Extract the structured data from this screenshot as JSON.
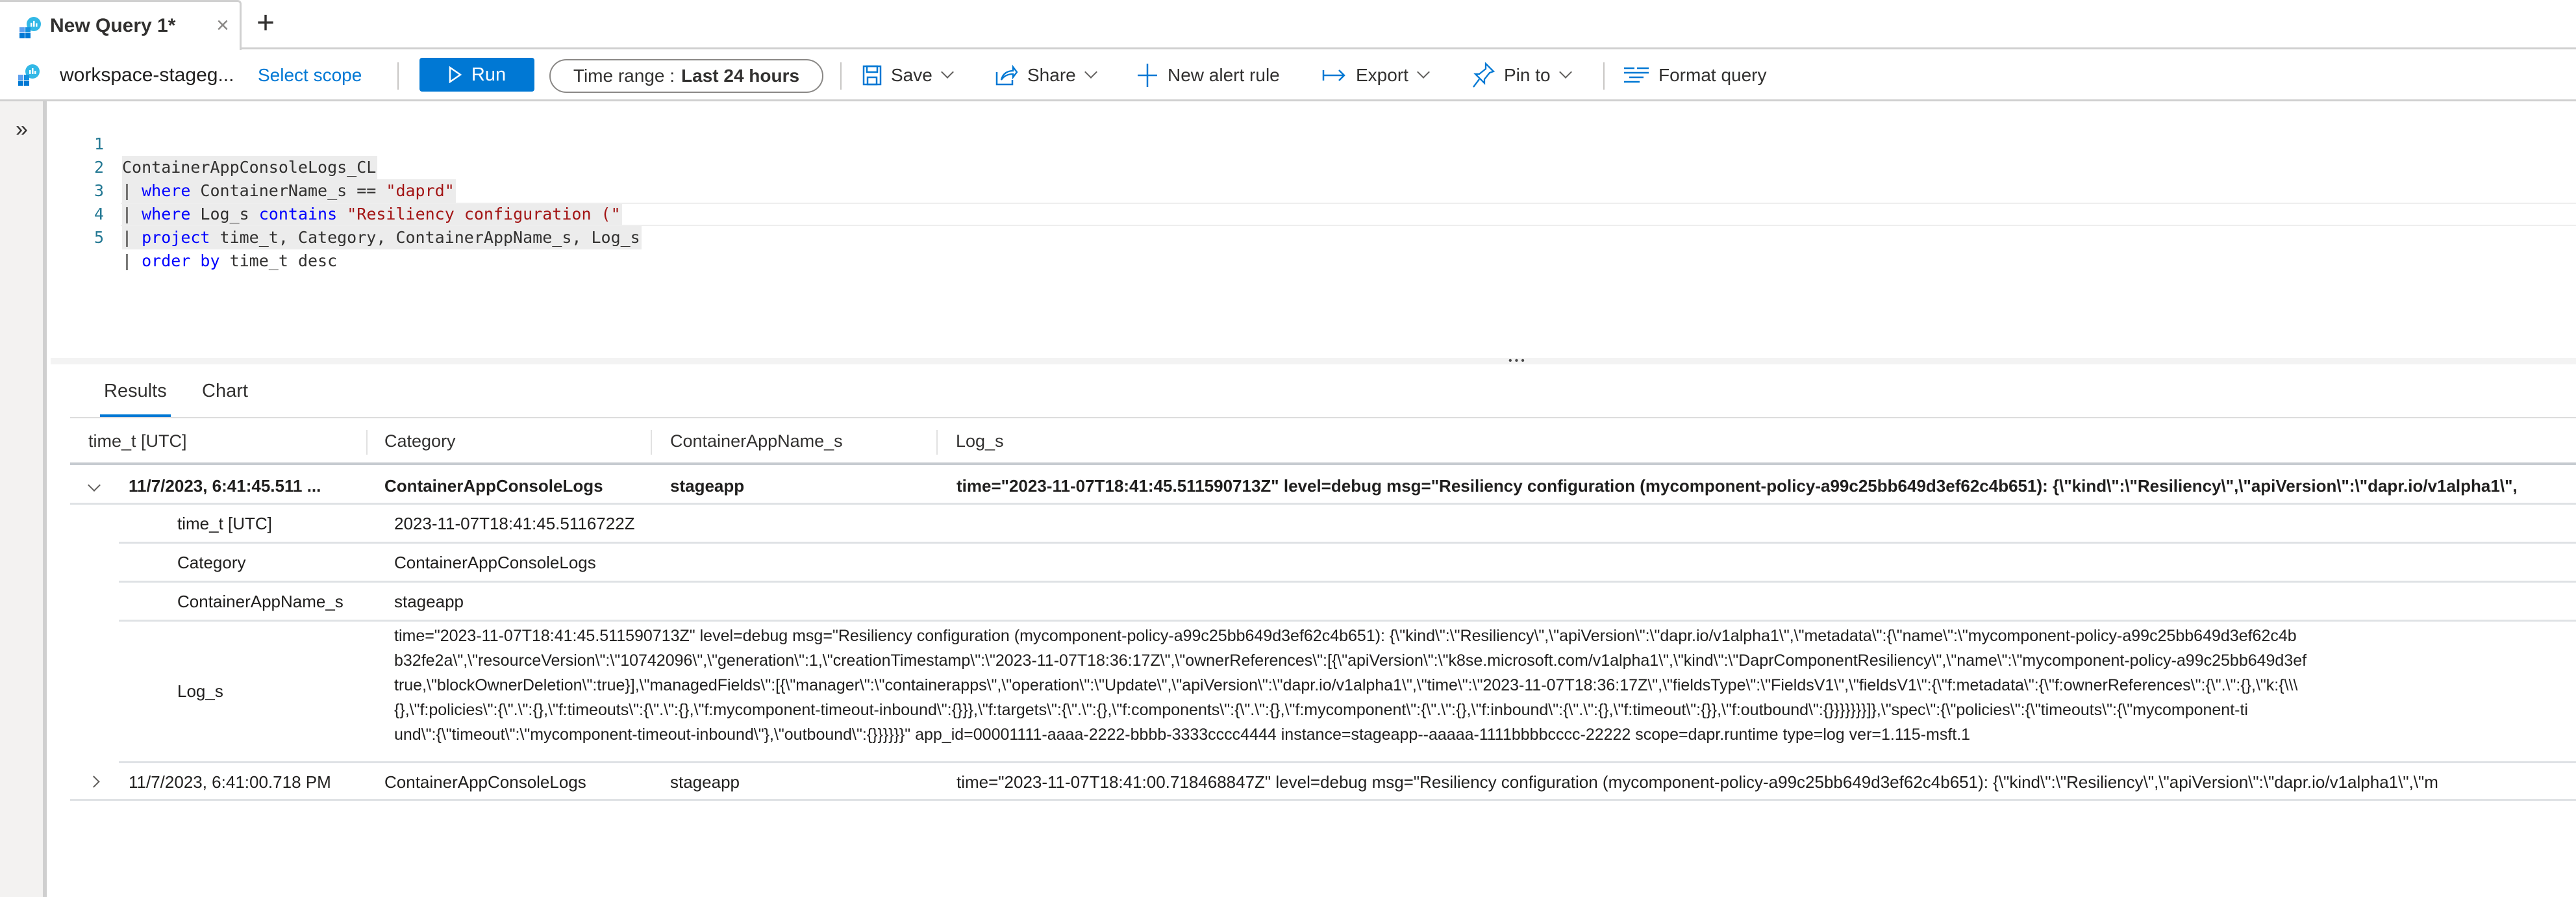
{
  "tab": {
    "title": "New Query 1*",
    "close_icon": "×",
    "add_icon": "+"
  },
  "toolbar": {
    "workspace": "workspace-stageg...",
    "select_scope": "Select scope",
    "run": "Run",
    "time_range_label": "Time range :",
    "time_range_value": "Last 24 hours",
    "save": "Save",
    "share": "Share",
    "new_alert_rule": "New alert rule",
    "export": "Export",
    "pin_to": "Pin to",
    "format_query": "Format query"
  },
  "rail": {
    "expand_icon": "»"
  },
  "editor": {
    "lines": [
      {
        "n": "1",
        "text": "ContainerAppConsoleLogs_CL"
      },
      {
        "n": "2",
        "pipe": "| ",
        "kw": "where",
        "mid": " ContainerName_s == ",
        "str": "\"daprd\""
      },
      {
        "n": "3",
        "pipe": "| ",
        "kw": "where",
        "mid": " Log_s ",
        "kw2": "contains",
        "mid2": " ",
        "str": "\"Resiliency configuration (\""
      },
      {
        "n": "4",
        "pipe": "| ",
        "kw": "project",
        "mid": " time_t, Category, ContainerAppName_s, Log_s"
      },
      {
        "n": "5",
        "pipe": "| ",
        "kw": "order by",
        "mid": " time_t desc"
      }
    ]
  },
  "splitter": {
    "dots": "•••"
  },
  "results": {
    "tabs": [
      {
        "label": "Results",
        "active": true
      },
      {
        "label": "Chart",
        "active": false
      }
    ],
    "columns": [
      "time_t [UTC]",
      "Category",
      "ContainerAppName_s",
      "Log_s"
    ],
    "rows": [
      {
        "expanded": true,
        "time": "11/7/2023, 6:41:45.511 ...",
        "category": "ContainerAppConsoleLogs",
        "app": "stageapp",
        "log": "time=\"2023-11-07T18:41:45.511590713Z\" level=debug msg=\"Resiliency configuration (mycomponent-policy-a99c25bb649d3ef62c4b651): {\\\"kind\\\":\\\"Resiliency\\\",\\\"apiVersion\\\":\\\"dapr.io/v1alpha1\\\",",
        "details": {
          "time_label": "time_t [UTC]",
          "time_value": "2023-11-07T18:41:45.5116722Z",
          "category_label": "Category",
          "category_value": "ContainerAppConsoleLogs",
          "app_label": "ContainerAppName_s",
          "app_value": "stageapp",
          "log_label": "Log_s",
          "log_lines": [
            "time=\"2023-11-07T18:41:45.511590713Z\" level=debug msg=\"Resiliency configuration (mycomponent-policy-a99c25bb649d3ef62c4b651): {\\\"kind\\\":\\\"Resiliency\\\",\\\"apiVersion\\\":\\\"dapr.io/v1alpha1\\\",\\\"metadata\\\":{\\\"name\\\":\\\"mycomponent-policy-a99c25bb649d3ef62c4b",
            "b32fe2a\\\",\\\"resourceVersion\\\":\\\"10742096\\\",\\\"generation\\\":1,\\\"creationTimestamp\\\":\\\"2023-11-07T18:36:17Z\\\",\\\"ownerReferences\\\":[{\\\"apiVersion\\\":\\\"k8se.microsoft.com/v1alpha1\\\",\\\"kind\\\":\\\"DaprComponentResiliency\\\",\\\"name\\\":\\\"mycomponent-policy-a99c25bb649d3ef",
            "true,\\\"blockOwnerDeletion\\\":true}],\\\"managedFields\\\":[{\\\"manager\\\":\\\"containerapps\\\",\\\"operation\\\":\\\"Update\\\",\\\"apiVersion\\\":\\\"dapr.io/v1alpha1\\\",\\\"time\\\":\\\"2023-11-07T18:36:17Z\\\",\\\"fieldsType\\\":\\\"FieldsV1\\\",\\\"fieldsV1\\\":{\\\"f:metadata\\\":{\\\"f:ownerReferences\\\":{\\\".\\\":{},\\\"k:{\\\\\\",
            "{},\\\"f:policies\\\":{\\\".\\\":{},\\\"f:timeouts\\\":{\\\".\\\":{},\\\"f:mycomponent-timeout-inbound\\\":{}}},\\\"f:targets\\\":{\\\".\\\":{},\\\"f:components\\\":{\\\".\\\":{},\\\"f:mycomponent\\\":{\\\".\\\":{},\\\"f:inbound\\\":{\\\".\\\":{},\\\"f:timeout\\\":{}},\\\"f:outbound\\\":{}}}}}}}]},\\\"spec\\\":{\\\"policies\\\":{\\\"timeouts\\\":{\\\"mycomponent-ti",
            "und\\\":{\\\"timeout\\\":\\\"mycomponent-timeout-inbound\\\"},\\\"outbound\\\":{}}}}}}\" app_id=00001111-aaaa-2222-bbbb-3333cccc4444 instance=stageapp--aaaaa-1111bbbbcccc-22222 scope=dapr.runtime type=log ver=1.115-msft.1"
          ]
        }
      },
      {
        "expanded": false,
        "time": "11/7/2023, 6:41:00.718 PM",
        "category": "ContainerAppConsoleLogs",
        "app": "stageapp",
        "log": "time=\"2023-11-07T18:41:00.718468847Z\" level=debug msg=\"Resiliency configuration (mycomponent-policy-a99c25bb649d3ef62c4b651): {\\\"kind\\\":\\\"Resiliency\\\",\\\"apiVersion\\\":\\\"dapr.io/v1alpha1\\\",\\\"m"
      }
    ]
  },
  "colors": {
    "accent": "#0078d4",
    "keyword": "#0000ff",
    "string": "#a31515",
    "line_number": "#237893"
  }
}
